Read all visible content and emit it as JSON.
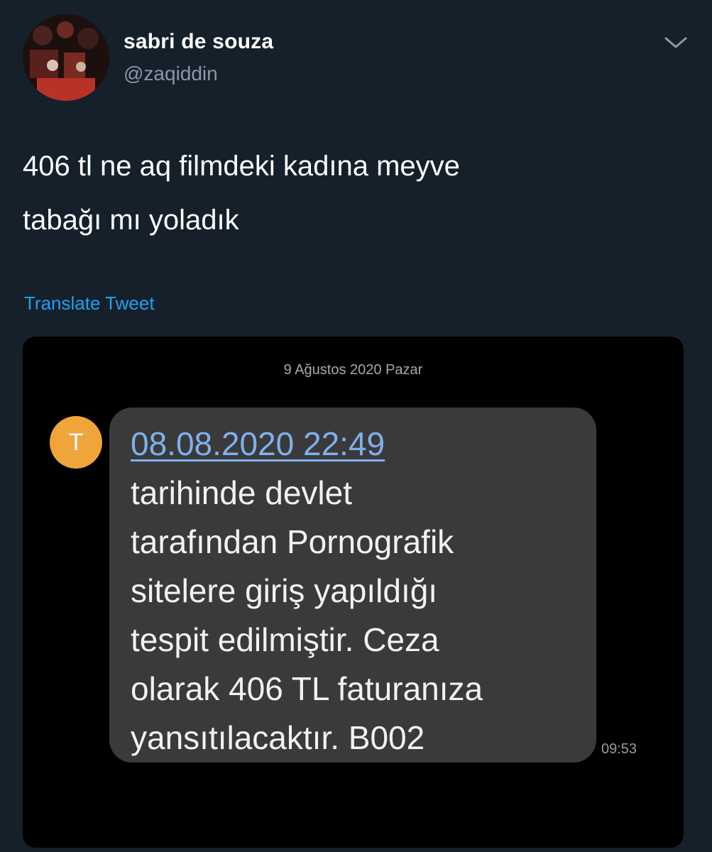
{
  "tweet": {
    "user_name": "sabri de souza",
    "user_handle": "@zaqiddin",
    "text_lines": [
      "406 tl ne aq filmdeki kadına meyve",
      "tabağı mı yoladık"
    ],
    "translate_label": "Translate Tweet",
    "more_icon": "chevron-down-icon",
    "colors": {
      "background": "#15202b",
      "link": "#1da1f2",
      "secondary_text": "#8899a6"
    }
  },
  "sms": {
    "date_header": "9 Ağustos 2020 Pazar",
    "sender_initial": "T",
    "link_text": "08.08.2020 22:49",
    "body_lines": [
      "tarihinde devlet",
      "tarafından Pornografik",
      "sitelere giriş yapıldığı",
      "tespit edilmiştir. Ceza",
      "olarak 406 TL faturanıza",
      "yansıtılacaktır. B002"
    ],
    "time": "09:53",
    "colors": {
      "sender_avatar": "#f0a53a",
      "bubble": "#3a3a3a",
      "link": "#7fb0ee"
    }
  }
}
